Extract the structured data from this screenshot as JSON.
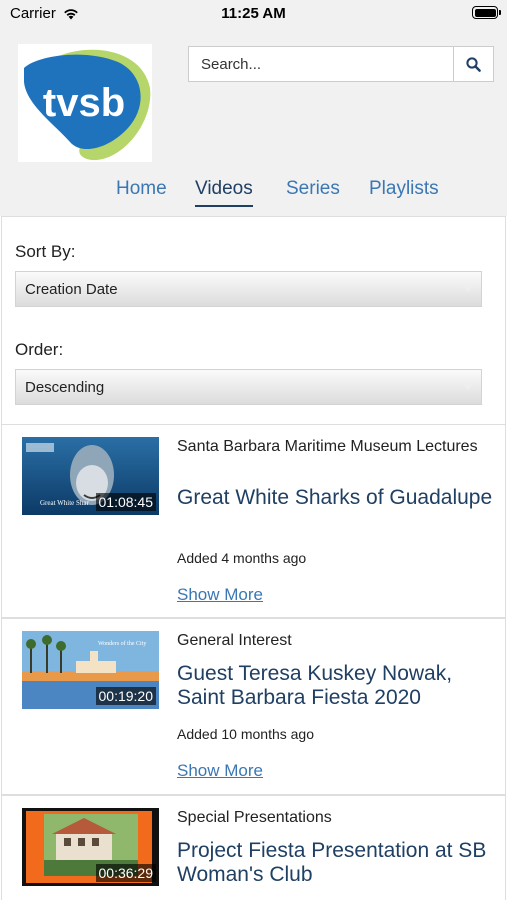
{
  "status_bar": {
    "carrier": "Carrier",
    "time": "11:25 AM"
  },
  "logo": {
    "text": "tvsb",
    "colors": {
      "blue": "#1f73bd",
      "green": "#b6d56a"
    }
  },
  "search": {
    "placeholder": "Search...",
    "icon": "magnifier-icon"
  },
  "nav": {
    "items": [
      {
        "label": "Home",
        "active": false
      },
      {
        "label": "Videos",
        "active": true
      },
      {
        "label": "Series",
        "active": false
      },
      {
        "label": "Playlists",
        "active": false
      }
    ]
  },
  "filters": {
    "sort_label": "Sort By:",
    "sort_value": "Creation Date",
    "order_label": "Order:",
    "order_value": "Descending"
  },
  "videos": [
    {
      "category": "Santa Barbara Maritime Museum Lectures",
      "title": "Great White Sharks of Guadalupe",
      "duration": "01:08:45",
      "added": "Added 4 months ago",
      "more": "Show More",
      "thumb_caption": "Great White Shar"
    },
    {
      "category": "General Interest",
      "title": "Guest Teresa Kuskey Nowak, Saint Barbara Fiesta 2020",
      "duration": "00:19:20",
      "added": "Added 10 months ago",
      "more": "Show More",
      "thumb_caption": "Wonders of the City"
    },
    {
      "category": "Special Presentations",
      "title": "Project Fiesta Presentation at SB Woman's Club",
      "duration": "00:36:29"
    }
  ],
  "colors": {
    "link": "#3a77b3",
    "title": "#1f3f63",
    "header_bg": "#f1f1f1"
  }
}
